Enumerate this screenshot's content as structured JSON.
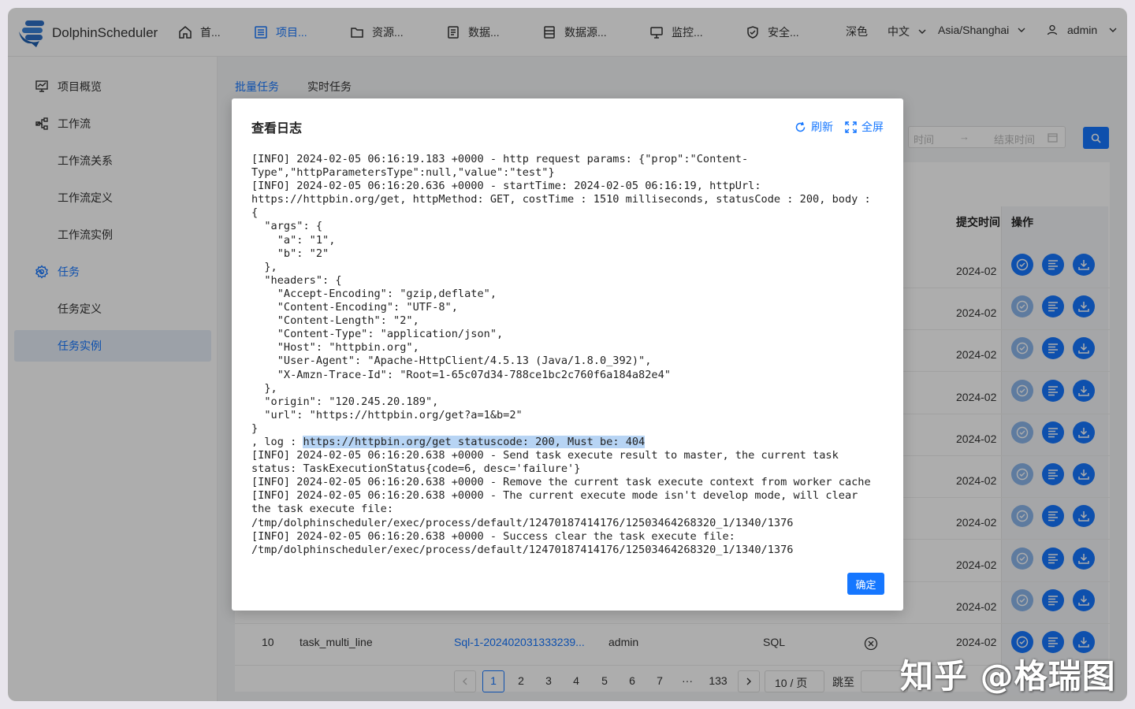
{
  "header": {
    "app_name": "DolphinScheduler",
    "nav": [
      {
        "label": "首...",
        "icon": "home-icon"
      },
      {
        "label": "项目...",
        "icon": "project-list-icon"
      },
      {
        "label": "资源...",
        "icon": "folder-icon"
      },
      {
        "label": "数据...",
        "icon": "data-doc-icon"
      },
      {
        "label": "数据源...",
        "icon": "datasource-icon"
      },
      {
        "label": "监控...",
        "icon": "monitor-icon"
      },
      {
        "label": "安全...",
        "icon": "shield-icon"
      }
    ],
    "theme": "深色",
    "language": "中文",
    "timezone": "Asia/Shanghai",
    "user": "admin"
  },
  "sidebar": {
    "items": [
      {
        "label": "项目概览",
        "icon": "chart-icon"
      },
      {
        "label": "工作流",
        "icon": "workflow-icon"
      },
      {
        "label": "工作流关系"
      },
      {
        "label": "工作流定义"
      },
      {
        "label": "工作流实例"
      },
      {
        "label": "任务",
        "icon": "gear-icon"
      },
      {
        "label": "任务定义"
      },
      {
        "label": "任务实例"
      }
    ]
  },
  "main": {
    "tabs": [
      "批量任务",
      "实时任务"
    ],
    "date_range_placeholder_start": "时间",
    "date_range_placeholder_end": "结束时间",
    "columns": {
      "submit_time": "提交时间",
      "operation": "操作"
    },
    "date_cell": "2024-02",
    "row10": {
      "index": "10",
      "name": "task_multi_line",
      "instance": "Sql-1-202402031333239...",
      "user": "admin",
      "type": "SQL"
    },
    "pagination": {
      "pages": [
        "1",
        "2",
        "3",
        "4",
        "5",
        "6",
        "7",
        "···",
        "133"
      ],
      "page_size": "10 / 页",
      "jump_label": "跳至"
    }
  },
  "modal": {
    "title": "查看日志",
    "refresh": "刷新",
    "fullscreen": "全屏",
    "log_before": "[INFO] 2024-02-05 06:16:19.183 +0000 - http request params: {\"prop\":\"Content-\nType\",\"httpParametersType\":null,\"value\":\"test\"}\n[INFO] 2024-02-05 06:16:20.636 +0000 - startTime: 2024-02-05 06:16:19, httpUrl:\nhttps://httpbin.org/get, httpMethod: GET, costTime : 1510 milliseconds, statusCode : 200, body :\n{\n  \"args\": {\n    \"a\": \"1\",\n    \"b\": \"2\"\n  },\n  \"headers\": {\n    \"Accept-Encoding\": \"gzip,deflate\",\n    \"Content-Encoding\": \"UTF-8\",\n    \"Content-Length\": \"2\",\n    \"Content-Type\": \"application/json\",\n    \"Host\": \"httpbin.org\",\n    \"User-Agent\": \"Apache-HttpClient/4.5.13 (Java/1.8.0_392)\",\n    \"X-Amzn-Trace-Id\": \"Root=1-65c07d34-788ce1bc2c760f6a184a82e4\"\n  },\n  \"origin\": \"120.245.20.189\",\n  \"url\": \"https://httpbin.org/get?a=1&b=2\"\n}\n, log : ",
    "log_highlight": "https://httpbin.org/get statuscode: 200, Must be: 404",
    "log_after": "\n[INFO] 2024-02-05 06:16:20.638 +0000 - Send task execute result to master, the current task\nstatus: TaskExecutionStatus{code=6, desc='failure'}\n[INFO] 2024-02-05 06:16:20.638 +0000 - Remove the current task execute context from worker cache\n[INFO] 2024-02-05 06:16:20.638 +0000 - The current execute mode isn't develop mode, will clear\nthe task execute file:\n/tmp/dolphinscheduler/exec/process/default/12470187414176/12503464268320_1/1340/1376\n[INFO] 2024-02-05 06:16:20.638 +0000 - Success clear the task execute file:\n/tmp/dolphinscheduler/exec/process/default/12470187414176/12503464268320_1/1340/1376",
    "ok_label": "确定"
  },
  "watermark": "知乎 @格瑞图",
  "colors": {
    "accent": "#1677ff",
    "selected_bg": "#e6edf8",
    "highlight": "#b7d4f4"
  }
}
